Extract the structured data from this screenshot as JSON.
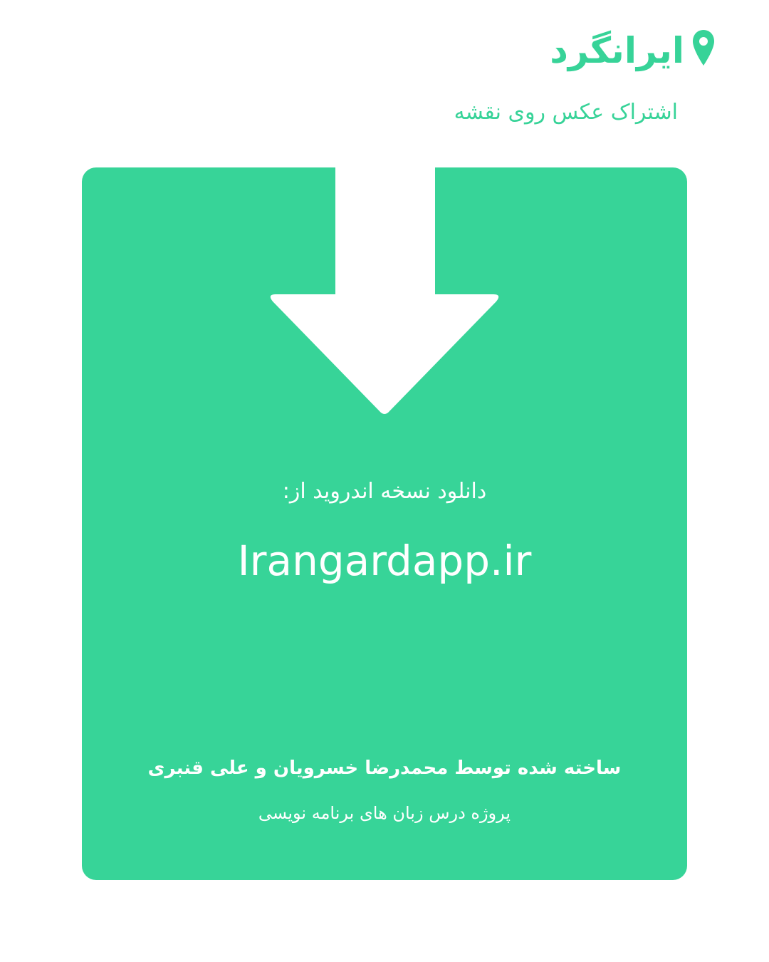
{
  "brand": {
    "name": "ایرانگرد",
    "tagline": "اشتراک عکس روی نقشه",
    "icon": "map-pin-icon"
  },
  "card": {
    "icon": "download-arrow-icon",
    "download_label": "دانلود نسخه اندروید از:",
    "url": "Irangardapp.ir",
    "credits": "ساخته شده توسط محمدرضا خسرویان و علی قنبری",
    "course": "پروژه درس زبان های برنامه نویسی"
  },
  "colors": {
    "accent": "#37d498",
    "text_light": "#ffffff",
    "background": "#ffffff"
  }
}
